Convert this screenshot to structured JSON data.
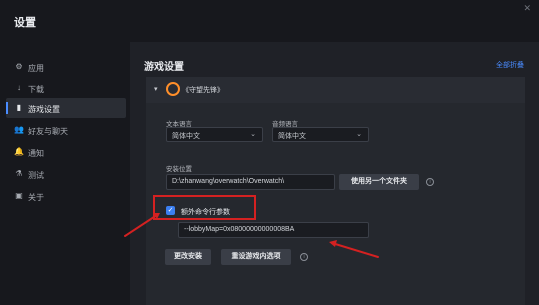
{
  "window": {
    "title": "设置",
    "close_icon": "close-icon"
  },
  "sidebar": {
    "items": [
      {
        "label": "应用",
        "icon": "gear-icon"
      },
      {
        "label": "下载",
        "icon": "download-icon"
      },
      {
        "label": "游戏设置",
        "icon": "game-settings-icon"
      },
      {
        "label": "好友与聊天",
        "icon": "friends-icon"
      },
      {
        "label": "通知",
        "icon": "bell-icon"
      },
      {
        "label": "测试",
        "icon": "test-icon"
      },
      {
        "label": "关于",
        "icon": "document-icon"
      }
    ]
  },
  "main": {
    "heading": "游戏设置",
    "collapse_all": "全部折叠",
    "game_name": "《守望先锋》",
    "text_language": {
      "label": "文本语言",
      "value": "简体中文"
    },
    "audio_language": {
      "label": "音频语言",
      "value": "简体中文"
    },
    "install_location": {
      "label": "安装位置",
      "value": "D:\\zhanwang\\overwatch\\Overwatch\\"
    },
    "use_other_folder": "使用另一个文件夹",
    "extra_cmd_args": "额外命令行参数",
    "cmd_args_value": "--lobbyMap=0x08000000000008BA",
    "change_install": "更改安装",
    "reset_ingame": "重设游戏内选项"
  },
  "colors": {
    "accent": "#4a8cff",
    "highlight": "#d42121"
  }
}
